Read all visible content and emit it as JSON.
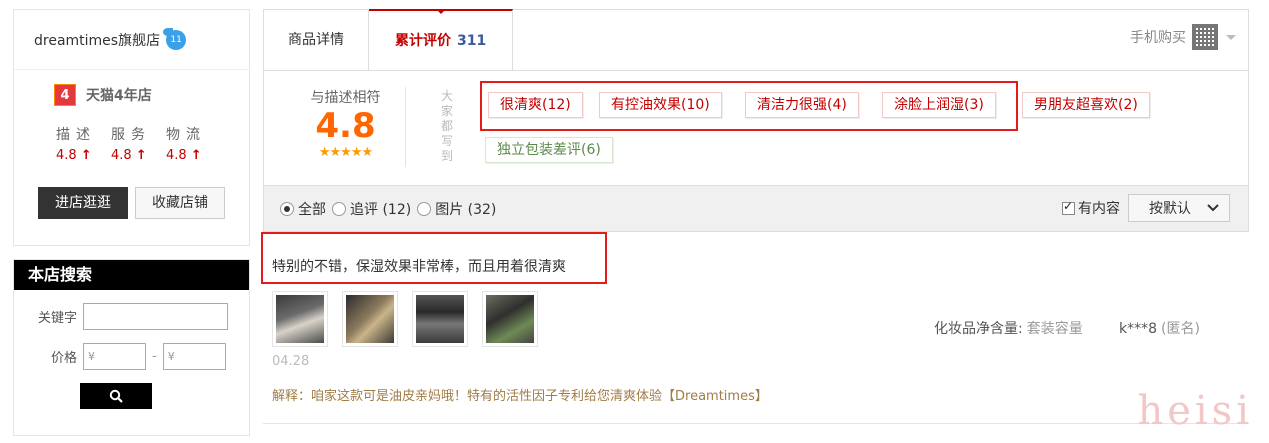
{
  "shop": {
    "name": "dreamtimes旗舰店",
    "badge": "11",
    "years_num": "4",
    "years_text": "天猫4年店",
    "dsr": [
      {
        "label": "描述",
        "value": "4.8"
      },
      {
        "label": "服务",
        "value": "4.8"
      },
      {
        "label": "物流",
        "value": "4.8"
      }
    ],
    "dsr_arrow": "↑",
    "enter_label": "进店逛逛",
    "fav_label": "收藏店铺"
  },
  "search": {
    "title": "本店搜索",
    "keyword_label": "关键字",
    "keyword_value": "",
    "price_label": "价格",
    "price_min_placeholder": "¥",
    "price_max_placeholder": "¥",
    "price_sep": "-"
  },
  "tabs": {
    "details": "商品详情",
    "reviews": "累计评价",
    "review_count": "311",
    "mobile_buy": "手机购买"
  },
  "rating": {
    "label": "与描述相符",
    "score": "4.8",
    "stars": "★★★★★",
    "vertical_label": [
      "大",
      "家",
      "都",
      "写",
      "到"
    ],
    "tags": [
      {
        "text": "很清爽(12)",
        "sentiment": "pos"
      },
      {
        "text": "有控油效果(10)",
        "sentiment": "pos"
      },
      {
        "text": "清洁力很强(4)",
        "sentiment": "pos"
      },
      {
        "text": "涂脸上润湿(3)",
        "sentiment": "pos"
      },
      {
        "text": "男朋友超喜欢(2)",
        "sentiment": "pos"
      },
      {
        "text": "独立包装差评(6)",
        "sentiment": "neg"
      }
    ]
  },
  "filters": {
    "all": "全部",
    "followup": "追评 (12)",
    "pictures": "图片 (32)",
    "has_content": "有内容",
    "sort": "按默认"
  },
  "review": {
    "text": "特别的不错，保湿效果非常棒，而且用着很清爽",
    "date": "04.28",
    "sku_label": "化妆品净含量:",
    "sku_value": "套装容量",
    "user": "k***8",
    "anon": "(匿名)",
    "reply": "解释：咱家这款可是油皮亲妈哦！特有的活性因子专利给您清爽体验【Dreamtimes】"
  },
  "watermark": "heisi",
  "colors": {
    "accent": "#c40000",
    "score": "#ff6600",
    "highlight_box": "#e31b1b",
    "reply": "#a07c46"
  }
}
